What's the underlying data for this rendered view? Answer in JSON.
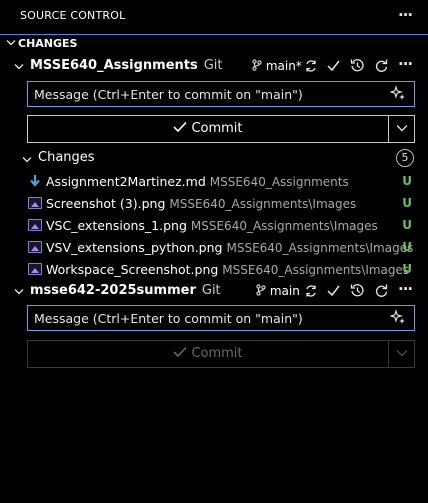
{
  "panel": {
    "title": "SOURCE CONTROL",
    "more_icon": "more-icon"
  },
  "changes_section": {
    "label": "CHANGES"
  },
  "repos": [
    {
      "name": "MSSE640_Assignments",
      "kind": "Git",
      "branch": "main*",
      "commit_placeholder": "Message (Ctrl+Enter to commit on \"main\")",
      "commit_label": "Commit",
      "changes_group": {
        "label": "Changes",
        "count": "5",
        "files": [
          {
            "name": "Assignment2Martinez.md",
            "path": "MSSE640_Assignments",
            "status": "U",
            "icon": "markdown-file-icon"
          },
          {
            "name": "Screenshot (3).png",
            "path": "MSSE640_Assignments\\Images",
            "status": "U",
            "icon": "image-file-icon"
          },
          {
            "name": "VSC_extensions_1.png",
            "path": "MSSE640_Assignments\\Images",
            "status": "U",
            "icon": "image-file-icon"
          },
          {
            "name": "VSV_extensions_python.png",
            "path": "MSSE640_Assignments\\Images",
            "status": "U",
            "icon": "image-file-icon"
          },
          {
            "name": "Workspace_Screenshot.png",
            "path": "MSSE640_Assignments\\Images",
            "status": "U",
            "icon": "image-file-icon"
          }
        ]
      }
    },
    {
      "name": "msse642-2025summer",
      "kind": "Git",
      "branch": "main",
      "commit_placeholder": "Message (Ctrl+Enter to commit on \"main\")",
      "commit_label": "Commit"
    }
  ],
  "colors": {
    "accent": "#5fa4e6",
    "status_untracked": "#6bbf59"
  }
}
